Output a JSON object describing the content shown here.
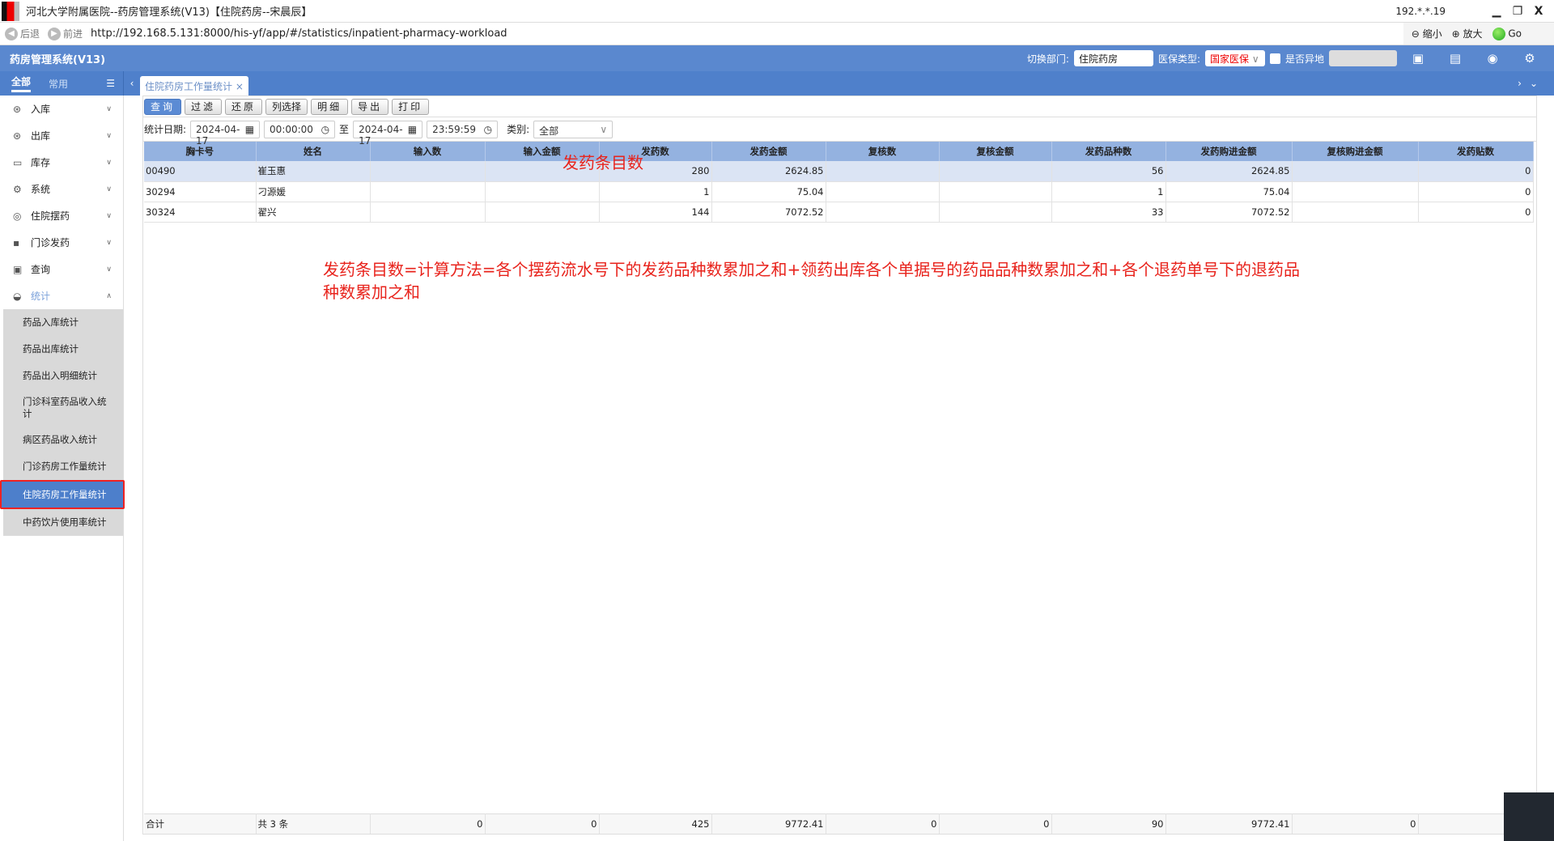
{
  "window": {
    "title": "河北大学附属医院--药房管理系统(V13)【住院药房--宋晨辰】",
    "ip": "192.*.*.19",
    "minimize": "▁",
    "restore": "❐",
    "close": "X"
  },
  "browser": {
    "back": "后退",
    "forward": "前进",
    "url": "http://192.168.5.131:8000/his-yf/app/#/statistics/inpatient-pharmacy-workload",
    "zoom_out": "缩小",
    "zoom_in": "放大",
    "go": "Go"
  },
  "header": {
    "app_name": "药房管理系统(V13)",
    "dept_label": "切换部门:",
    "dept_value": "住院药房",
    "insurance_label": "医保类型:",
    "insurance_value": "国家医保",
    "remote_label": "是否异地"
  },
  "sidebar": {
    "tabs": [
      "全部",
      "常用"
    ],
    "items": [
      {
        "label": "入库"
      },
      {
        "label": "出库"
      },
      {
        "label": "库存"
      },
      {
        "label": "系统"
      },
      {
        "label": "住院摆药"
      },
      {
        "label": "门诊发药"
      },
      {
        "label": "查询"
      },
      {
        "label": "统计"
      }
    ],
    "sub_items": [
      "药品入库统计",
      "药品出库统计",
      "药品出入明细统计",
      "门诊科室药品收入统计",
      "病区药品收入统计",
      "门诊药房工作量统计",
      "住院药房工作量统计",
      "中药饮片使用率统计"
    ]
  },
  "tab": {
    "label": "住院药房工作量统计"
  },
  "toolbar": [
    "查询",
    "过滤",
    "还原",
    "列选择",
    "明细",
    "导出",
    "打印"
  ],
  "filter": {
    "date_label": "统计日期:",
    "start_date": "2024-04-17",
    "start_time": "00:00:00",
    "to": "至",
    "end_date": "2024-04-17",
    "end_time": "23:59:59",
    "category_label": "类别:",
    "category_value": "全部"
  },
  "table": {
    "columns": [
      "胸卡号",
      "姓名",
      "输入数",
      "输入金额",
      "发药数",
      "发药金额",
      "复核数",
      "复核金额",
      "发药品种数",
      "发药购进金额",
      "复核购进金额",
      "发药贴数"
    ],
    "rows": [
      [
        "00490",
        "崔玉惠",
        "",
        "",
        "280",
        "2624.85",
        "",
        "",
        "56",
        "2624.85",
        "",
        "0"
      ],
      [
        "30294",
        "刁源媛",
        "",
        "",
        "1",
        "75.04",
        "",
        "",
        "1",
        "75.04",
        "",
        "0"
      ],
      [
        "30324",
        "翟兴",
        "",
        "",
        "144",
        "7072.52",
        "",
        "",
        "33",
        "7072.52",
        "",
        "0"
      ]
    ],
    "footer": [
      "合计",
      "共 3 条",
      "0",
      "0",
      "425",
      "9772.41",
      "0",
      "0",
      "90",
      "9772.41",
      "0",
      ""
    ]
  },
  "annotations": {
    "header_note": "发药条目数",
    "formula": "发药条目数=计算方法=各个摆药流水号下的发药品种数累加之和+领药出库各个单据号的药品品种数累加之和+各个退药单号下的退药品种数累加之和"
  }
}
